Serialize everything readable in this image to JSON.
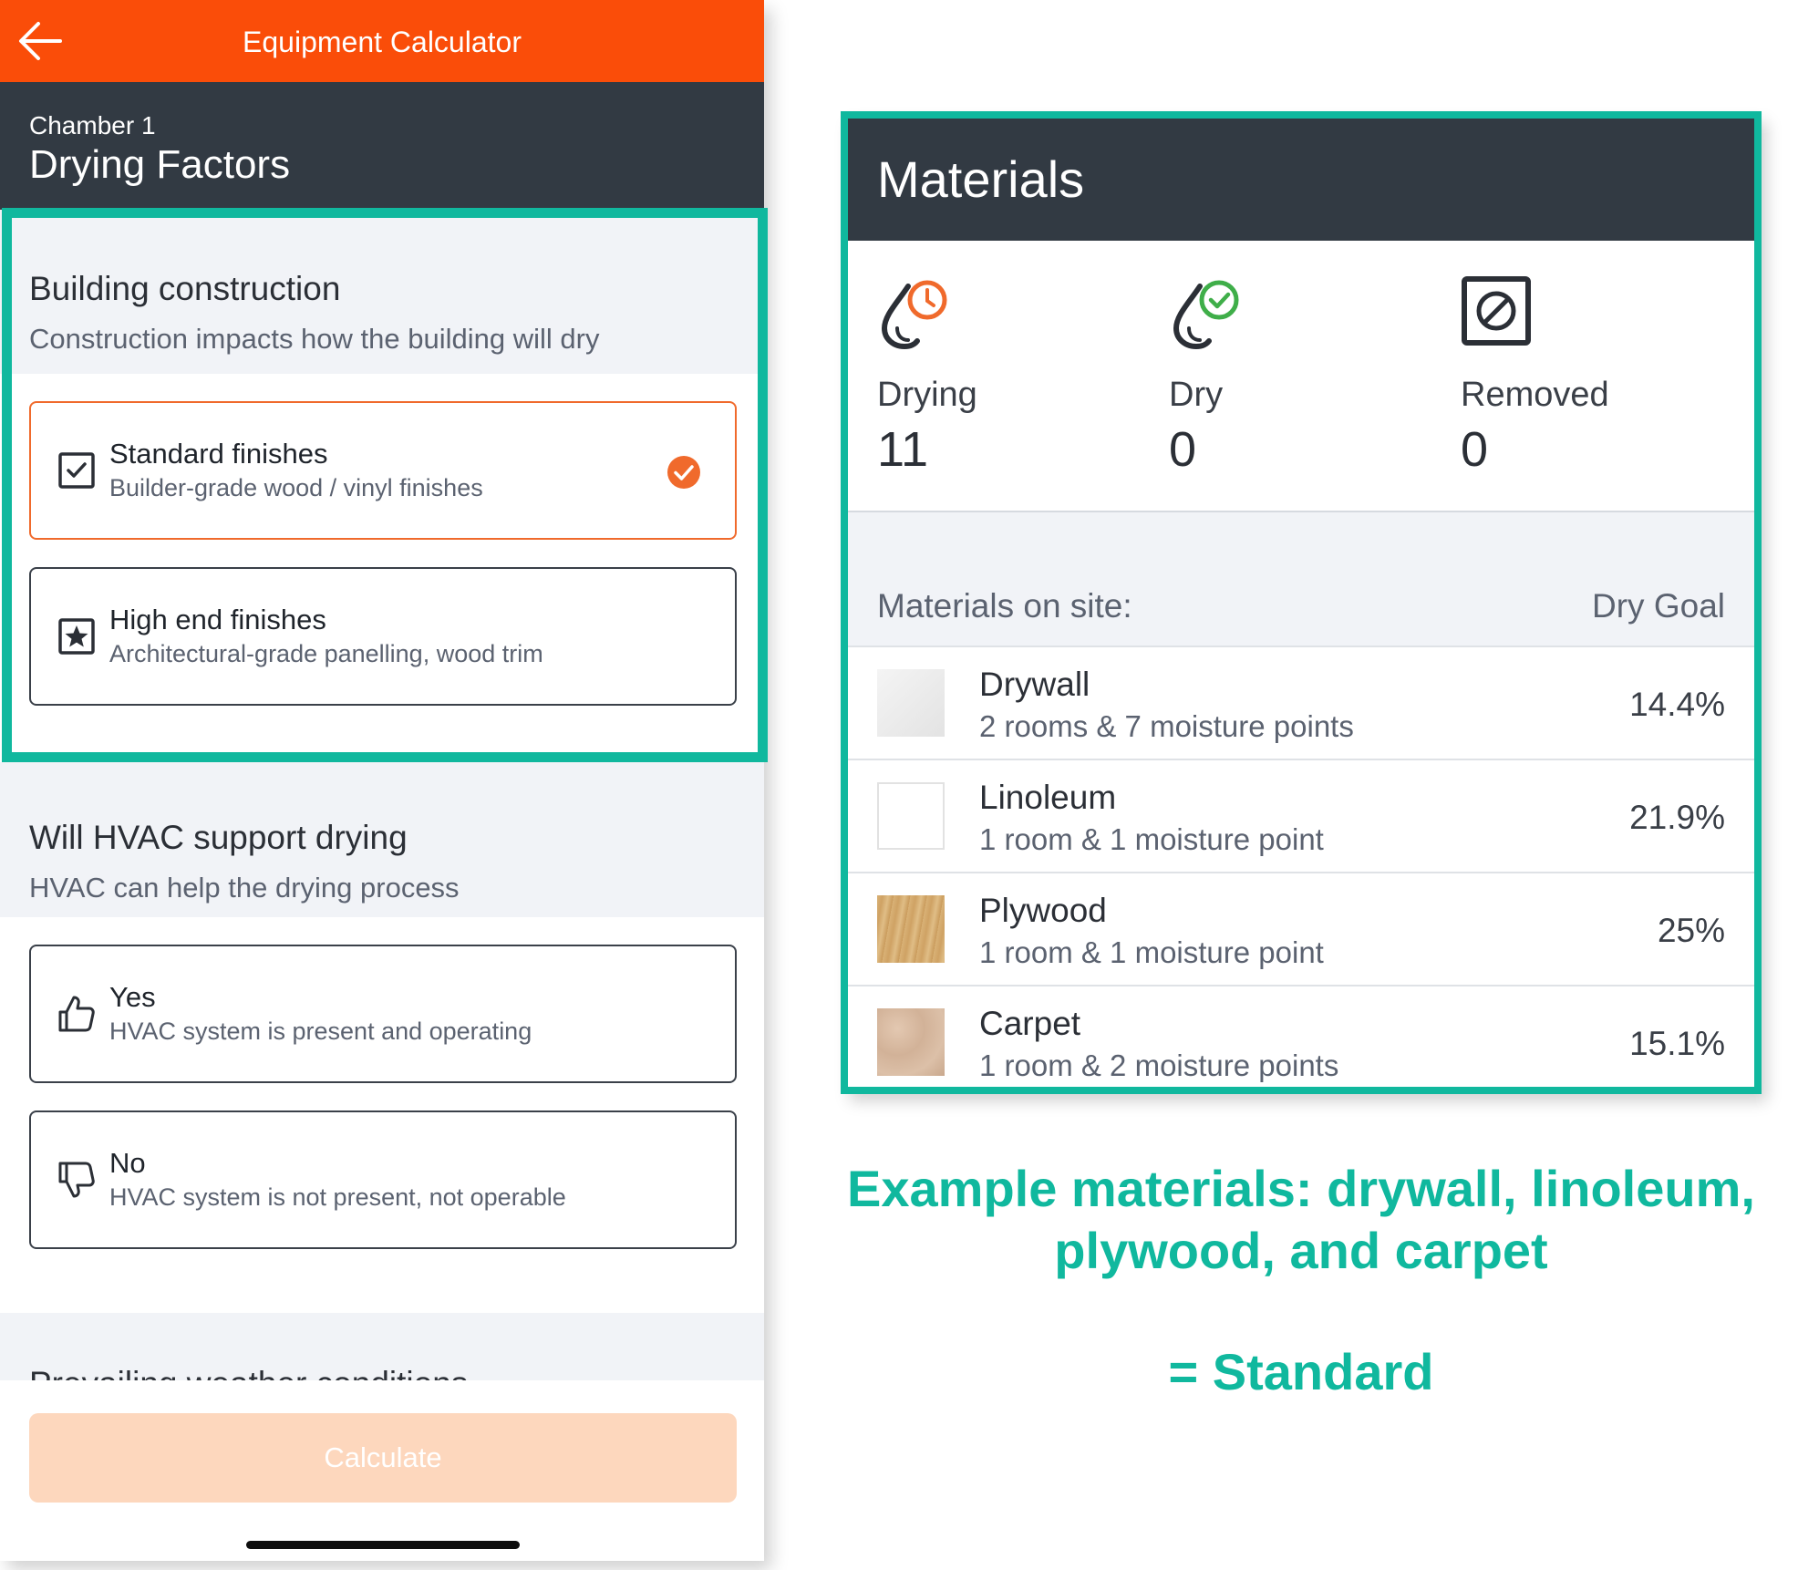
{
  "phone": {
    "app_title": "Equipment Calculator",
    "chamber_label": "Chamber 1",
    "page_title": "Drying Factors",
    "building": {
      "title": "Building construction",
      "description": "Construction impacts how the building will dry",
      "options": [
        {
          "title": "Standard finishes",
          "subtitle": "Builder-grade wood / vinyl finishes",
          "icon": "checkbox-square-icon",
          "selected": true
        },
        {
          "title": "High end finishes",
          "subtitle": "Architectural-grade panelling, wood trim",
          "icon": "star-square-icon",
          "selected": false
        }
      ]
    },
    "hvac": {
      "title": "Will HVAC support drying",
      "description": "HVAC can help the drying process",
      "options": [
        {
          "title": "Yes",
          "subtitle": "HVAC system is present and operating",
          "icon": "thumbs-up-icon",
          "selected": false
        },
        {
          "title": "No",
          "subtitle": "HVAC system is not present, not operable",
          "icon": "thumbs-down-icon",
          "selected": false
        }
      ]
    },
    "weather_title": "Prevailing weather conditions",
    "calculate_label": "Calculate",
    "colors": {
      "header": "#fa4d09",
      "dark": "#323a43",
      "accent": "#f06a2c",
      "highlight": "#10b89e",
      "button_disabled": "#fdd7bd"
    }
  },
  "materials": {
    "title": "Materials",
    "stats": [
      {
        "label": "Drying",
        "value": "11",
        "icon": "drop-clock-icon"
      },
      {
        "label": "Dry",
        "value": "0",
        "icon": "drop-check-icon"
      },
      {
        "label": "Removed",
        "value": "0",
        "icon": "removed-square-icon"
      }
    ],
    "list_header": {
      "left": "Materials on site:",
      "right": "Dry Goal"
    },
    "items": [
      {
        "name": "Drywall",
        "detail": "2 rooms & 7 moisture points",
        "goal": "14.4%",
        "swatch": "#ededed"
      },
      {
        "name": "Linoleum",
        "detail": "1 room & 1 moisture point",
        "goal": "21.9%",
        "swatch": "#ffffff"
      },
      {
        "name": "Plywood",
        "detail": "1 room & 1 moisture point",
        "goal": "25%",
        "swatch": "#d6ad6e"
      },
      {
        "name": "Carpet",
        "detail": "1 room & 2 moisture points",
        "goal": "15.1%",
        "swatch": "#d9bba2"
      }
    ]
  },
  "annotation": {
    "line1": "Example materials: drywall, linoleum,",
    "line2": "plywood, and carpet",
    "equals": "= Standard"
  }
}
